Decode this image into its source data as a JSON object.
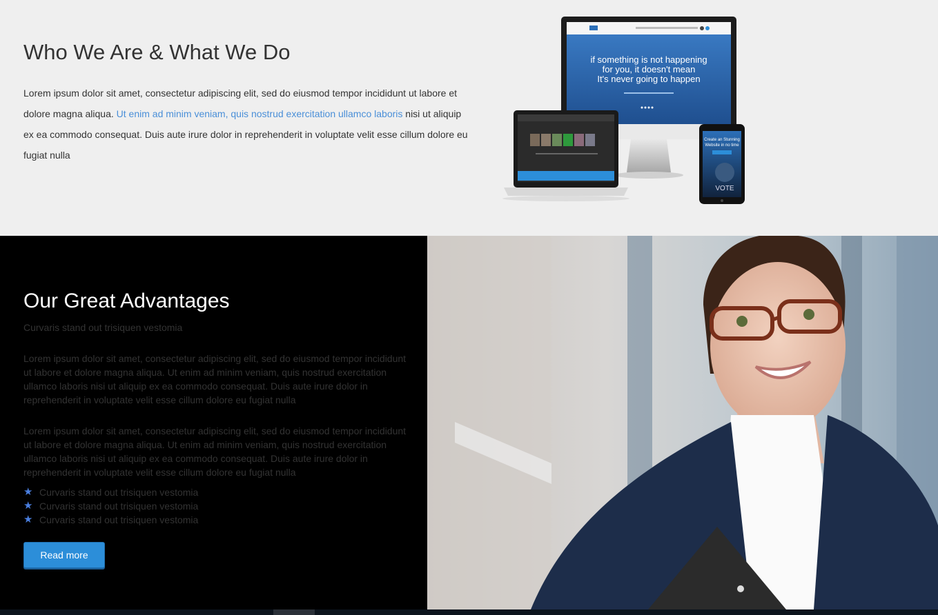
{
  "about": {
    "title": "Who We Are & What We Do",
    "text_before": "Lorem ipsum dolor sit amet, consectetur adipiscing elit, sed do eiusmod tempor incididunt ut labore et dolore magna aliqua. ",
    "link_text": "Ut enim ad minim veniam, quis nostrud exercitation ullamco laboris",
    "text_after": " nisi ut aliquip ex ea commodo consequat. Duis aute irure dolor in reprehenderit in voluptate velit esse cillum dolore eu fugiat nulla",
    "devices": {
      "monitor_headline_1": "if something is not happening",
      "monitor_headline_2": "for you, it doesn't mean",
      "monitor_headline_3": "It's never going to happen",
      "phone_text_1": "Create an Stunning",
      "phone_text_2": "Website in no time",
      "phone_vote": "VOTE"
    }
  },
  "advantages": {
    "title": "Our Great Advantages",
    "subtitle": "Curvaris stand out trisiquen vestomia",
    "paragraph_1": "Lorem ipsum dolor sit amet, consectetur adipiscing elit, sed do eiusmod tempor incididunt ut labore et dolore magna aliqua. Ut enim ad minim veniam, quis nostrud exercitation ullamco laboris nisi ut aliquip ex ea commodo consequat. Duis aute irure dolor in reprehenderit in voluptate velit esse cillum dolore eu fugiat nulla",
    "paragraph_2": "Lorem ipsum dolor sit amet, consectetur adipiscing elit, sed do eiusmod tempor incididunt ut labore et dolore magna aliqua. Ut enim ad minim veniam, quis nostrud exercitation ullamco laboris nisi ut aliquip ex ea commodo consequat. Duis aute irure dolor in reprehenderit in voluptate velit esse cillum dolore eu fugiat nulla",
    "features": [
      {
        "icon": "star-icon",
        "label": "Curvaris stand out trisiquen vestomia"
      },
      {
        "icon": "star-icon",
        "label": "Curvaris stand out trisiquen vestomia"
      },
      {
        "icon": "star-icon",
        "label": "Curvaris stand out trisiquen vestomia"
      }
    ],
    "button_label": "Read more"
  },
  "colors": {
    "accent": "#2c8ed9",
    "link": "#4a8fd8",
    "star": "#4a7fe0",
    "section_light": "#efefef",
    "section_dark": "#000000"
  }
}
